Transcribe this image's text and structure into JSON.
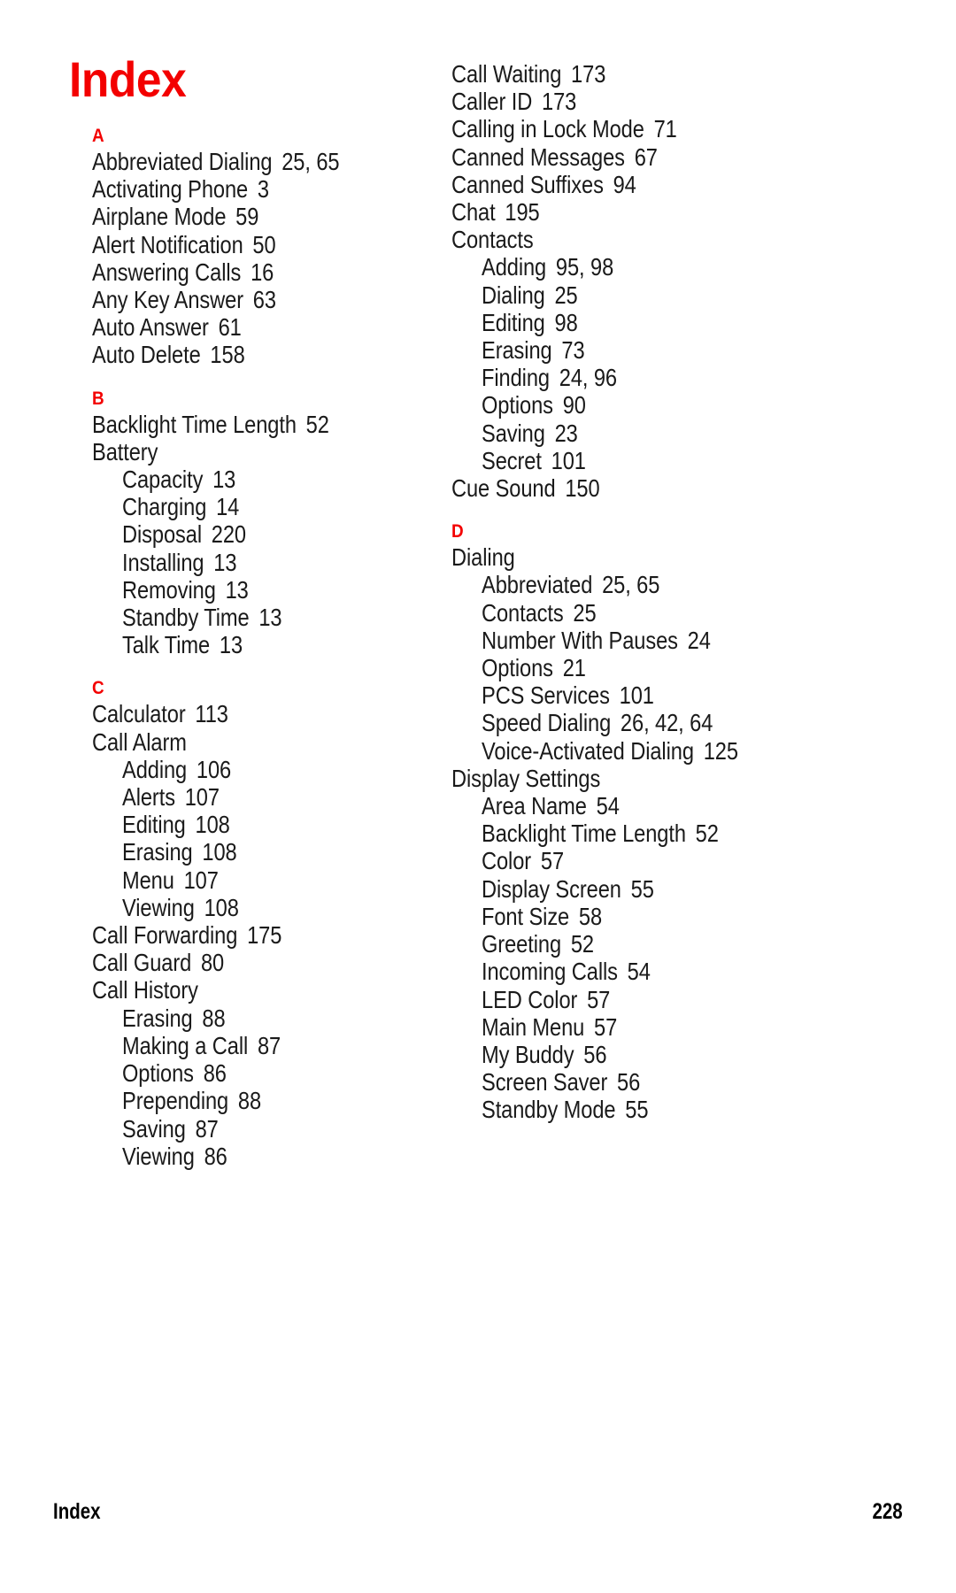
{
  "page": {
    "title": "Index",
    "accent_color": "#f30000",
    "text_color": "#1a1a1a",
    "background_color": "#ffffff"
  },
  "footer": {
    "label": "Index",
    "page_number": "228"
  },
  "columns": [
    {
      "name": "left-column",
      "sections": [
        {
          "letter": "A",
          "entries": [
            {
              "level": 0,
              "text": "Abbreviated Dialing",
              "pages": "25, 65"
            },
            {
              "level": 0,
              "text": "Activating Phone",
              "pages": "3"
            },
            {
              "level": 0,
              "text": "Airplane Mode",
              "pages": "59"
            },
            {
              "level": 0,
              "text": "Alert Notification",
              "pages": "50"
            },
            {
              "level": 0,
              "text": "Answering Calls",
              "pages": "16"
            },
            {
              "level": 0,
              "text": "Any Key Answer",
              "pages": "63"
            },
            {
              "level": 0,
              "text": "Auto Answer",
              "pages": "61"
            },
            {
              "level": 0,
              "text": "Auto Delete",
              "pages": "158"
            }
          ]
        },
        {
          "letter": "B",
          "entries": [
            {
              "level": 0,
              "text": "Backlight Time Length",
              "pages": "52"
            },
            {
              "level": 0,
              "text": "Battery",
              "pages": ""
            },
            {
              "level": 1,
              "text": "Capacity",
              "pages": "13"
            },
            {
              "level": 1,
              "text": "Charging",
              "pages": "14"
            },
            {
              "level": 1,
              "text": "Disposal",
              "pages": "220"
            },
            {
              "level": 1,
              "text": "Installing",
              "pages": "13"
            },
            {
              "level": 1,
              "text": "Removing",
              "pages": "13"
            },
            {
              "level": 1,
              "text": "Standby Time",
              "pages": "13"
            },
            {
              "level": 1,
              "text": "Talk Time",
              "pages": "13"
            }
          ]
        },
        {
          "letter": "C",
          "entries": [
            {
              "level": 0,
              "text": "Calculator",
              "pages": "113"
            },
            {
              "level": 0,
              "text": "Call Alarm",
              "pages": ""
            },
            {
              "level": 1,
              "text": "Adding",
              "pages": "106"
            },
            {
              "level": 1,
              "text": "Alerts",
              "pages": "107"
            },
            {
              "level": 1,
              "text": "Editing",
              "pages": "108"
            },
            {
              "level": 1,
              "text": "Erasing",
              "pages": "108"
            },
            {
              "level": 1,
              "text": "Menu",
              "pages": "107"
            },
            {
              "level": 1,
              "text": "Viewing",
              "pages": "108"
            },
            {
              "level": 0,
              "text": "Call Forwarding",
              "pages": "175"
            },
            {
              "level": 0,
              "text": "Call Guard",
              "pages": "80"
            },
            {
              "level": 0,
              "text": "Call History",
              "pages": ""
            },
            {
              "level": 1,
              "text": "Erasing",
              "pages": "88"
            },
            {
              "level": 1,
              "text": "Making a Call",
              "pages": "87"
            },
            {
              "level": 1,
              "text": "Options",
              "pages": "86"
            },
            {
              "level": 1,
              "text": "Prepending",
              "pages": "88"
            },
            {
              "level": 1,
              "text": "Saving",
              "pages": "87"
            },
            {
              "level": 1,
              "text": "Viewing",
              "pages": "86"
            }
          ]
        }
      ]
    },
    {
      "name": "right-column",
      "sections": [
        {
          "letter": "",
          "entries": [
            {
              "level": 0,
              "text": "Call Waiting",
              "pages": "173"
            },
            {
              "level": 0,
              "text": "Caller ID",
              "pages": "173"
            },
            {
              "level": 0,
              "text": "Calling in Lock Mode",
              "pages": "71"
            },
            {
              "level": 0,
              "text": "Canned Messages",
              "pages": "67"
            },
            {
              "level": 0,
              "text": "Canned Suffixes",
              "pages": "94"
            },
            {
              "level": 0,
              "text": "Chat",
              "pages": "195"
            },
            {
              "level": 0,
              "text": "Contacts",
              "pages": ""
            },
            {
              "level": 1,
              "text": "Adding",
              "pages": "95, 98"
            },
            {
              "level": 1,
              "text": "Dialing",
              "pages": "25"
            },
            {
              "level": 1,
              "text": "Editing",
              "pages": "98"
            },
            {
              "level": 1,
              "text": "Erasing",
              "pages": "73"
            },
            {
              "level": 1,
              "text": "Finding",
              "pages": "24, 96"
            },
            {
              "level": 1,
              "text": "Options",
              "pages": "90"
            },
            {
              "level": 1,
              "text": "Saving",
              "pages": "23"
            },
            {
              "level": 1,
              "text": "Secret",
              "pages": "101"
            },
            {
              "level": 0,
              "text": "Cue Sound",
              "pages": "150"
            }
          ]
        },
        {
          "letter": "D",
          "entries": [
            {
              "level": 0,
              "text": "Dialing",
              "pages": ""
            },
            {
              "level": 1,
              "text": "Abbreviated",
              "pages": "25, 65"
            },
            {
              "level": 1,
              "text": "Contacts",
              "pages": "25"
            },
            {
              "level": 1,
              "text": "Number With Pauses",
              "pages": "24"
            },
            {
              "level": 1,
              "text": "Options",
              "pages": "21"
            },
            {
              "level": 1,
              "text": "PCS Services",
              "pages": "101"
            },
            {
              "level": 1,
              "text": "Speed Dialing",
              "pages": "26, 42, 64"
            },
            {
              "level": 1,
              "text": "Voice-Activated Dialing",
              "pages": "125"
            },
            {
              "level": 0,
              "text": "Display Settings",
              "pages": ""
            },
            {
              "level": 1,
              "text": "Area Name",
              "pages": "54"
            },
            {
              "level": 1,
              "text": "Backlight Time Length",
              "pages": "52"
            },
            {
              "level": 1,
              "text": "Color",
              "pages": "57"
            },
            {
              "level": 1,
              "text": "Display Screen",
              "pages": "55"
            },
            {
              "level": 1,
              "text": "Font Size",
              "pages": "58"
            },
            {
              "level": 1,
              "text": "Greeting",
              "pages": "52"
            },
            {
              "level": 1,
              "text": "Incoming Calls",
              "pages": "54"
            },
            {
              "level": 1,
              "text": "LED Color",
              "pages": "57"
            },
            {
              "level": 1,
              "text": "Main Menu",
              "pages": "57"
            },
            {
              "level": 1,
              "text": "My Buddy",
              "pages": "56"
            },
            {
              "level": 1,
              "text": "Screen Saver",
              "pages": "56"
            },
            {
              "level": 1,
              "text": "Standby Mode",
              "pages": "55"
            }
          ]
        }
      ]
    }
  ]
}
